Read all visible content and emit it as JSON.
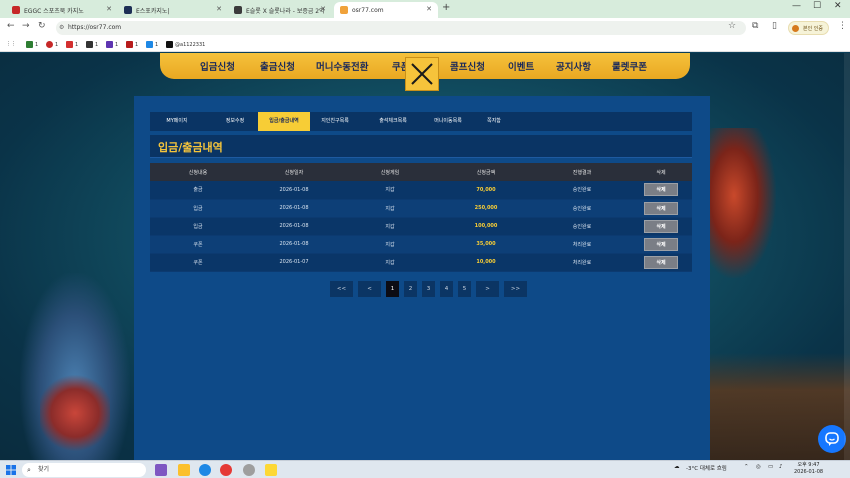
{
  "browser": {
    "tabs": [
      {
        "title": "EGGC 스포츠북 카지노",
        "color": "#c62828"
      },
      {
        "title": "E스포카지노|",
        "color": "#1d2f55"
      },
      {
        "title": "E슬롯 X 슬롯나라 - 보증금 2억",
        "color": "#3b3b3b"
      },
      {
        "title": "osr77.com",
        "color": "#f0a23b"
      }
    ],
    "url": "https://osr77.com",
    "profile_label": "본인 인증",
    "bookmarks": [
      {
        "label": "1",
        "color": "#2e7d32"
      },
      {
        "label": "1",
        "color": "#c62828"
      },
      {
        "label": "1",
        "color": "#d32f2f"
      },
      {
        "label": "1",
        "color": "#333333"
      },
      {
        "label": "1",
        "color": "#5e35b1"
      },
      {
        "label": "1",
        "color": "#b71c1c"
      },
      {
        "label": "1",
        "color": "#1e88e5"
      },
      {
        "label": "@a1122331",
        "color": "#111111"
      }
    ]
  },
  "nav": {
    "items": [
      "입금신청",
      "출금신청",
      "머니수동전환",
      "쿠폰",
      "콤프신청",
      "이벤트",
      "공지사항",
      "룰렛쿠폰"
    ]
  },
  "subtabs": [
    "MY페이지",
    "정보수정",
    "입금/출금내역",
    "지인친구목록",
    "출석체크목록",
    "머니이동목록",
    "쪽지함"
  ],
  "active_subtab_index": 2,
  "section_title": "입금/출금내역",
  "table": {
    "headers": [
      "신청내용",
      "신청일자",
      "신청게임",
      "신청금액",
      "진행결과",
      "삭제"
    ],
    "rows": [
      {
        "type": "출금",
        "date": "2026-01-08",
        "game": "지갑",
        "amount": "70,000",
        "result": "승인완료",
        "action": "삭제"
      },
      {
        "type": "입금",
        "date": "2026-01-08",
        "game": "지갑",
        "amount": "250,000",
        "result": "승인완료",
        "action": "삭제"
      },
      {
        "type": "입금",
        "date": "2026-01-08",
        "game": "지갑",
        "amount": "100,000",
        "result": "승인완료",
        "action": "삭제"
      },
      {
        "type": "쿠폰",
        "date": "2026-01-08",
        "game": "지갑",
        "amount": "35,000",
        "result": "처리완료",
        "action": "삭제"
      },
      {
        "type": "쿠폰",
        "date": "2026-01-07",
        "game": "지갑",
        "amount": "10,000",
        "result": "처리완료",
        "action": "삭제"
      }
    ]
  },
  "pagination": {
    "first": "<<",
    "prev": "<",
    "pages": [
      "1",
      "2",
      "3",
      "4",
      "5"
    ],
    "current": "1",
    "next": ">",
    "last": ">>"
  },
  "taskbar": {
    "search_placeholder": "찾기",
    "weather": "-3°C 대체로 흐림",
    "time": "오후 9:47",
    "date": "2026-01-08"
  },
  "colors": {
    "accent": "#f7cd36",
    "panel": "#0e4a88",
    "nav_bg": "#f5c23c"
  }
}
